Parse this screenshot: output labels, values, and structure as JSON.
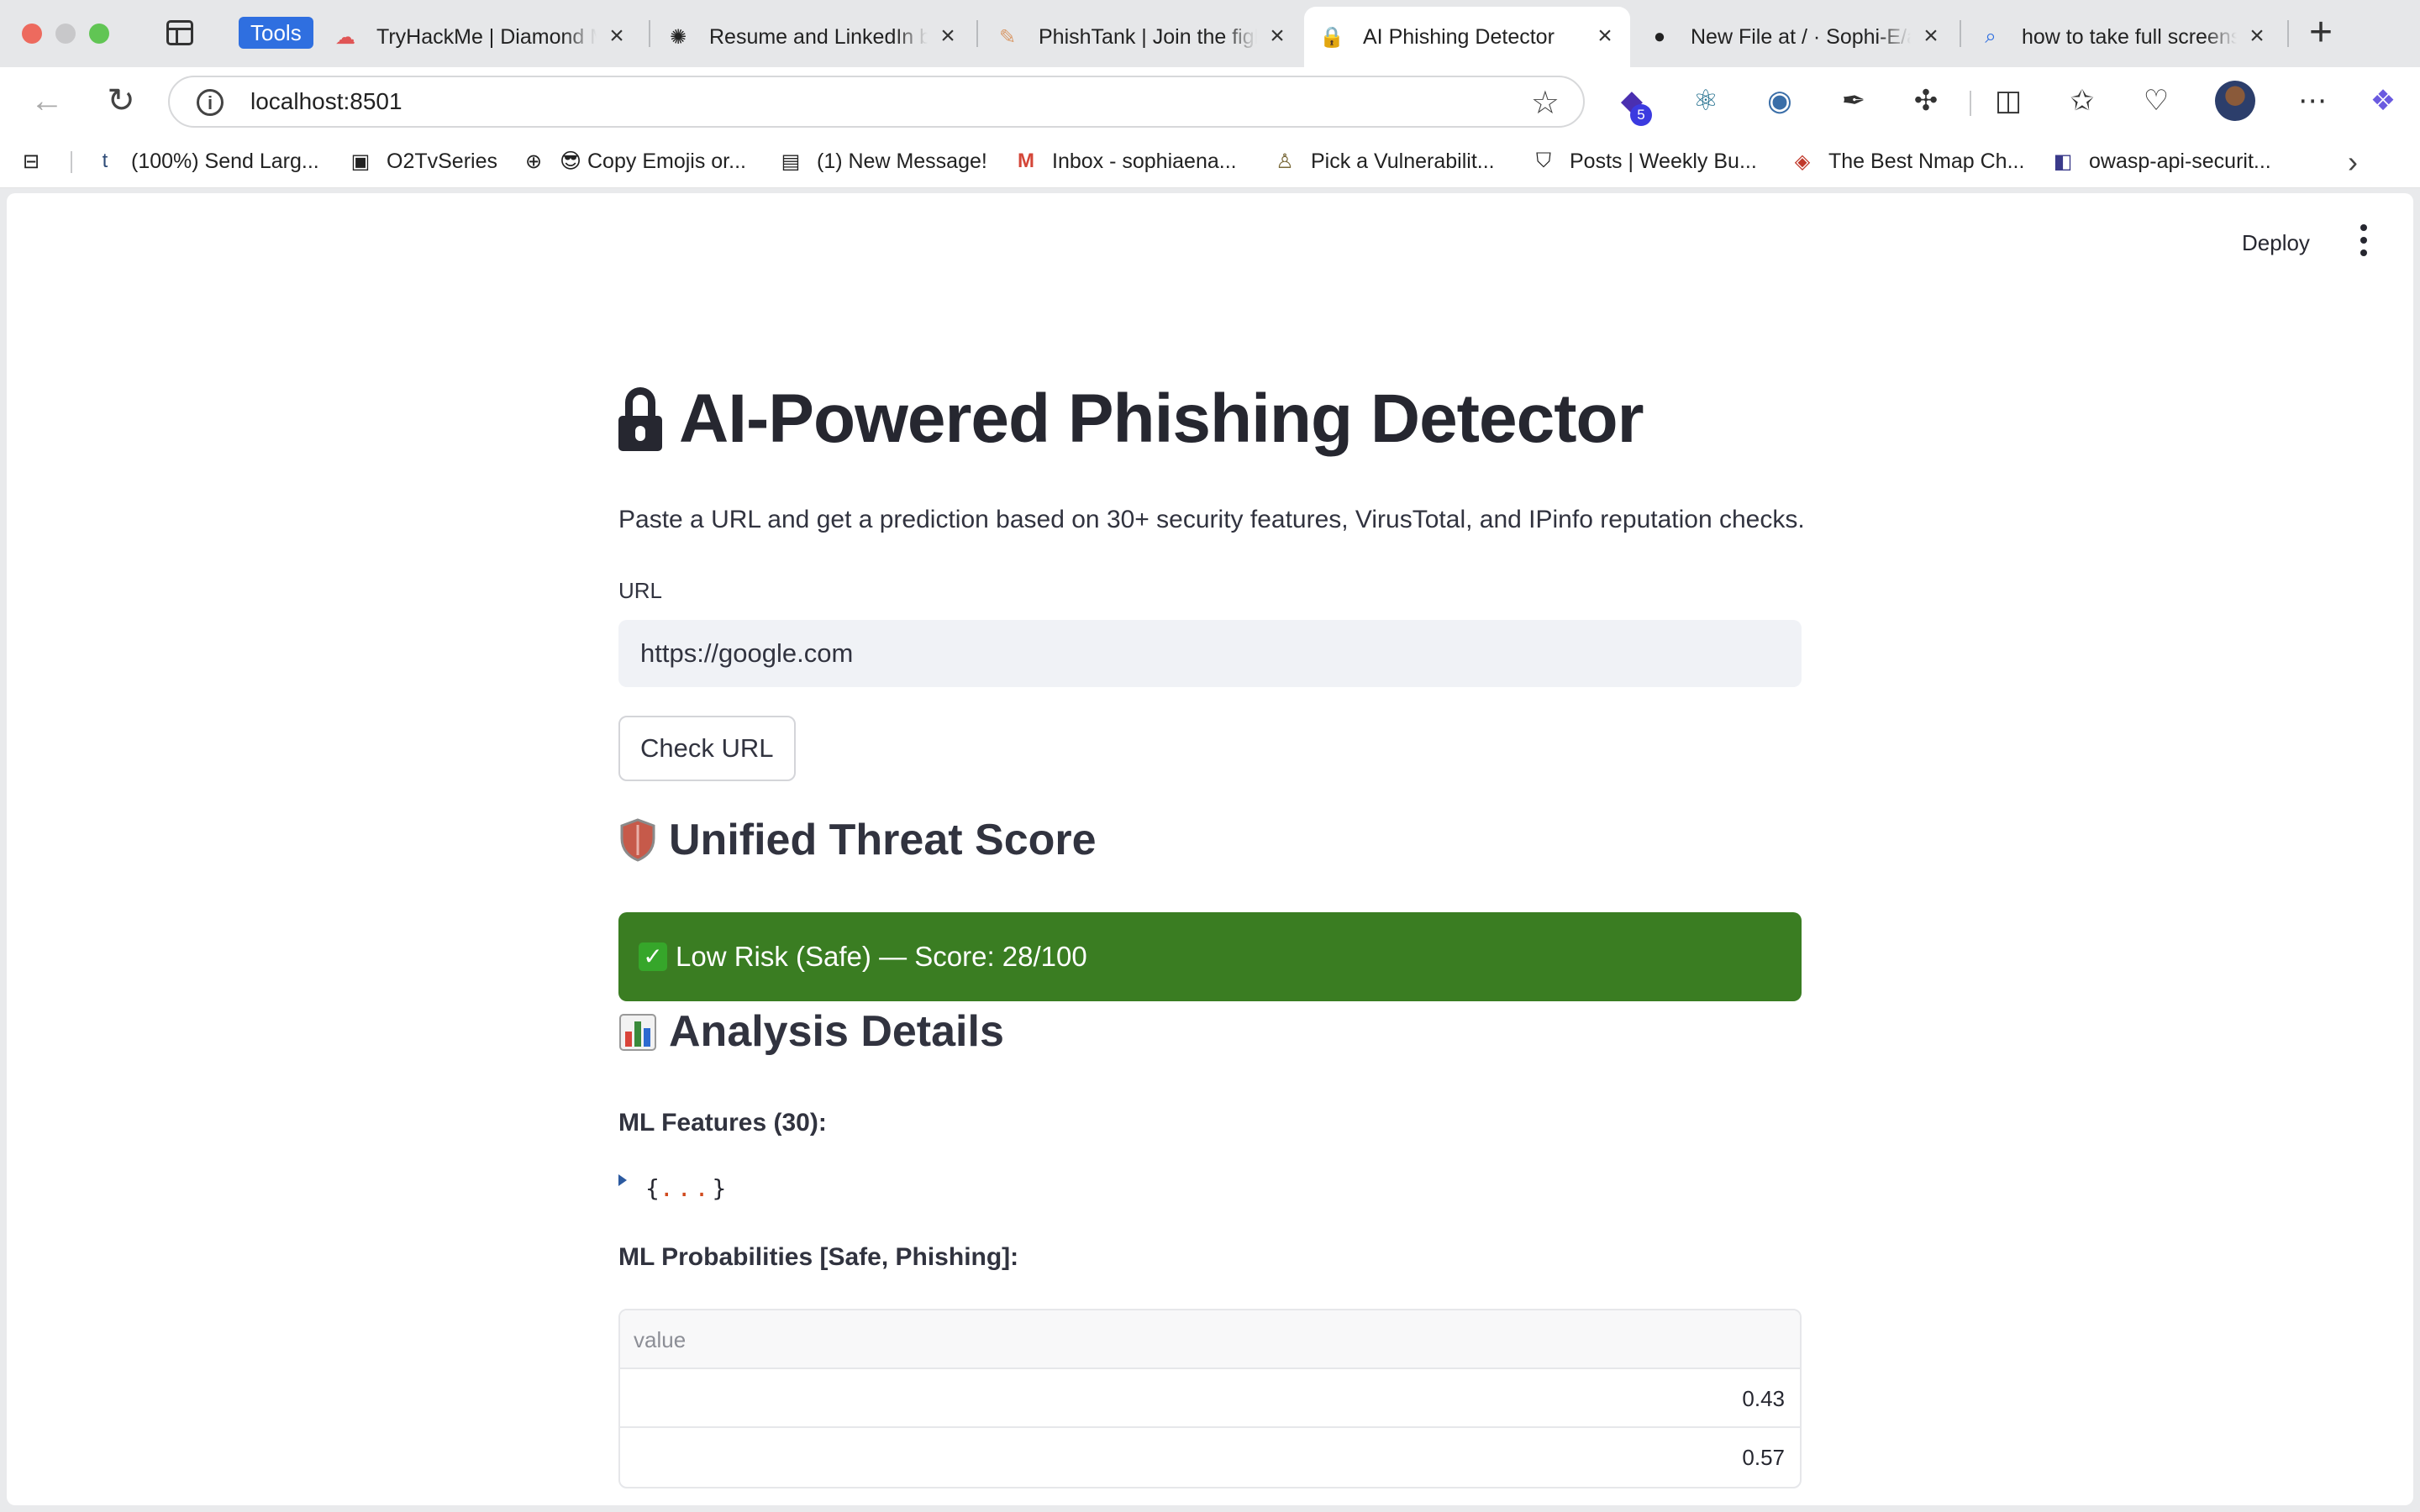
{
  "browser": {
    "tab_group_label": "Tools",
    "tabs": [
      {
        "title": "TryHackMe | Diamond M",
        "icon": "tryhackme-cloud-icon"
      },
      {
        "title": "Resume and LinkedIn b",
        "icon": "openai-icon"
      },
      {
        "title": "PhishTank | Join the figh",
        "icon": "phishtank-icon"
      },
      {
        "title": "AI Phishing Detector",
        "icon": "lock-icon"
      },
      {
        "title": "New File at / · Sophi-E/a",
        "icon": "github-icon"
      },
      {
        "title": "how to take full screens",
        "icon": "search-icon"
      }
    ],
    "address": "localhost:8501",
    "extension_badge": "5"
  },
  "bookmarks": [
    {
      "label": "(100%) Send Larg...",
      "icon": "tumblr-icon"
    },
    {
      "label": "O2TvSeries",
      "icon": "o2tv-icon"
    },
    {
      "label": "😎 Copy Emojis or...",
      "icon": "globe-icon"
    },
    {
      "label": "(1) New Message!",
      "icon": "message-icon"
    },
    {
      "label": "Inbox - sophiaena...",
      "icon": "gmail-icon"
    },
    {
      "label": "Pick a Vulnerabilit...",
      "icon": "figure-icon"
    },
    {
      "label": "Posts | Weekly Bu...",
      "icon": "shield-icon"
    },
    {
      "label": "The Best Nmap Ch...",
      "icon": "nmap-icon"
    },
    {
      "label": "owasp-api-securit...",
      "icon": "owasp-icon"
    }
  ],
  "app": {
    "deploy_label": "Deploy",
    "title": "AI-Powered Phishing Detector",
    "subtitle": "Paste a URL and get a prediction based on 30+ security features, VirusTotal, and IPinfo reputation checks.",
    "url_label": "URL",
    "url_value": "https://google.com",
    "check_button": "Check URL",
    "threat_heading": "Unified Threat Score",
    "result_text": "Low Risk (Safe) — Score: 28/100",
    "result_color": "#3a7d22",
    "analysis_heading": "Analysis Details",
    "features_label": "ML Features (30):",
    "features_json_open": "{",
    "features_json_dots": "...",
    "features_json_close": "}",
    "probabilities_label": "ML Probabilities [Safe, Phishing]:",
    "table": {
      "header": "value",
      "rows": [
        "0.43",
        "0.57"
      ]
    }
  }
}
